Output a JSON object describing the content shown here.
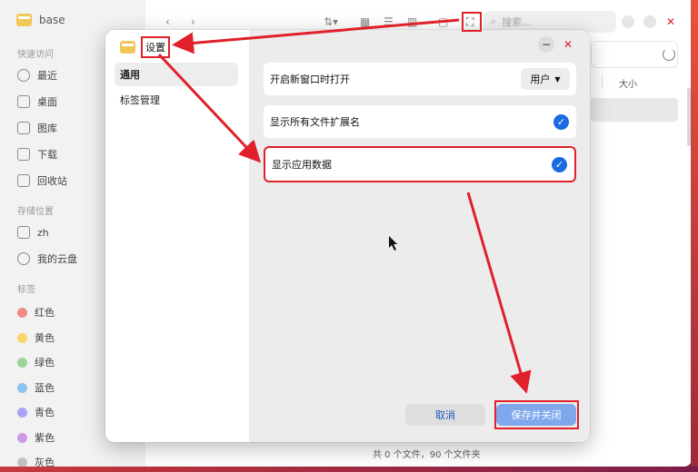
{
  "file_manager": {
    "folder_name": "base",
    "sections": {
      "quick_access": "快速访问",
      "storage": "存储位置",
      "tags": "标签"
    },
    "quick_items": [
      "最近",
      "桌面",
      "图库",
      "下载",
      "回收站"
    ],
    "storage_items": [
      "zh",
      "我的云盘"
    ],
    "tag_items": [
      {
        "label": "红色",
        "color": "#ef8b86"
      },
      {
        "label": "黄色",
        "color": "#f6d56a"
      },
      {
        "label": "绿色",
        "color": "#9ed49a"
      },
      {
        "label": "蓝色",
        "color": "#8fc3f0"
      },
      {
        "label": "青色",
        "color": "#a8a6f2"
      },
      {
        "label": "紫色",
        "color": "#cd9be6"
      },
      {
        "label": "灰色",
        "color": "#c2c2c2"
      }
    ],
    "search_placeholder": "搜索...",
    "column_size": "大小",
    "status_text": "共 0 个文件，90 个文件夹"
  },
  "dialog": {
    "title": "设置",
    "nav": [
      "通用",
      "标签管理"
    ],
    "settings": [
      {
        "label": "开启新窗口时打开",
        "control": "select",
        "value": "用户"
      },
      {
        "label": "显示所有文件扩展名",
        "control": "check",
        "checked": true
      },
      {
        "label": "显示应用数据",
        "control": "check",
        "checked": true
      }
    ],
    "cancel_label": "取消",
    "save_label": "保存并关闭"
  },
  "colors": {
    "accent": "#1a6ae0",
    "annotation": "#e0202a"
  }
}
